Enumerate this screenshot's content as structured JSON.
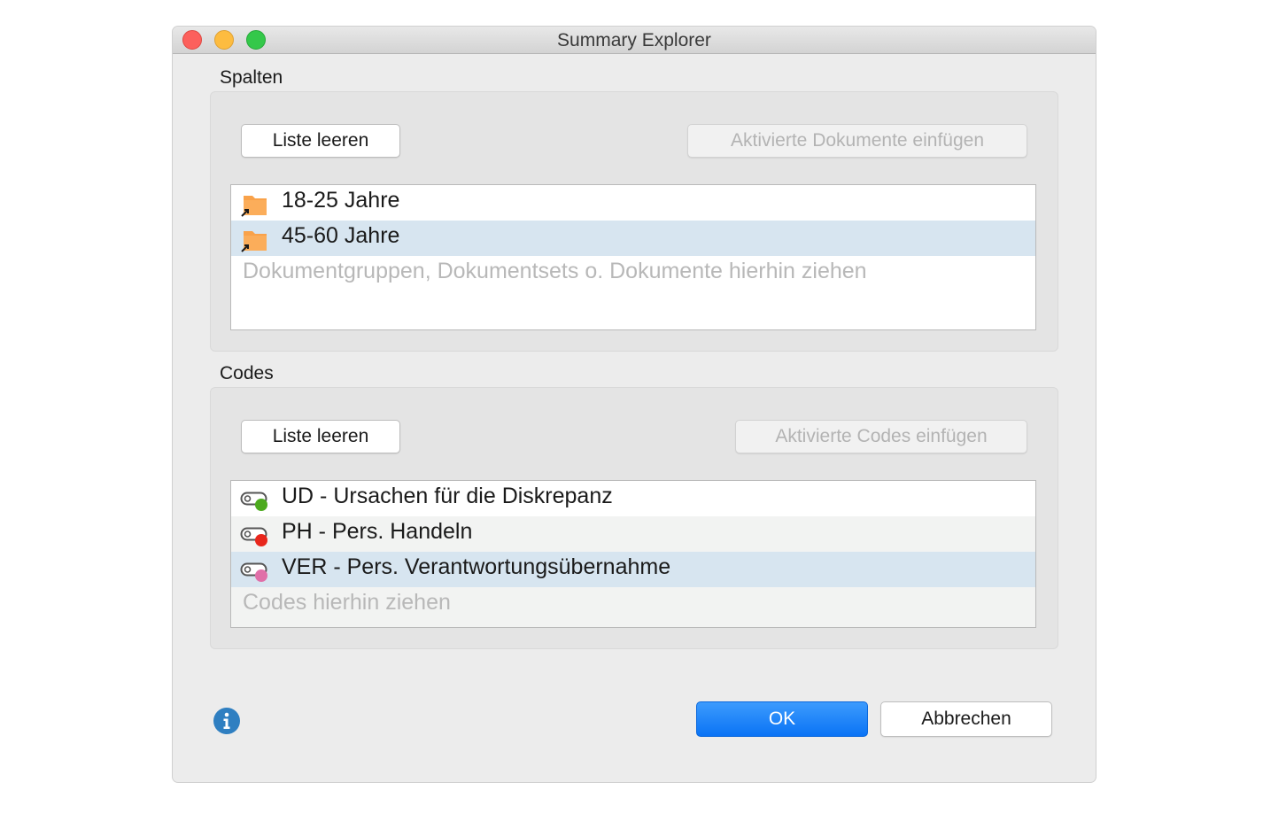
{
  "window": {
    "title": "Summary Explorer"
  },
  "columns_section": {
    "label": "Spalten",
    "clear_button": "Liste leeren",
    "insert_button": "Aktivierte Dokumente einfügen",
    "items": [
      {
        "label": "18-25 Jahre",
        "icon": "folder-alias-icon",
        "selected": false
      },
      {
        "label": "45-60 Jahre",
        "icon": "folder-alias-icon",
        "selected": true
      }
    ],
    "placeholder": "Dokumentgruppen, Dokumentsets o. Dokumente hierhin ziehen"
  },
  "codes_section": {
    "label": "Codes",
    "clear_button": "Liste leeren",
    "insert_button": "Aktivierte Codes einfügen",
    "items": [
      {
        "label": "UD - Ursachen für die Diskrepanz",
        "color": "#4caa1e",
        "selected": false
      },
      {
        "label": "PH - Pers. Handeln",
        "color": "#e8261c",
        "selected": false
      },
      {
        "label": "VER - Pers. Verantwortungsübernahme",
        "color": "#e06fa8",
        "selected": true
      }
    ],
    "placeholder": "Codes hierhin ziehen"
  },
  "footer": {
    "info_icon": "info-icon",
    "ok_label": "OK",
    "cancel_label": "Abbrechen"
  },
  "colors": {
    "folder": "#f9a24a",
    "accent": "#0a73f5",
    "selection": "#d7e5f0"
  }
}
